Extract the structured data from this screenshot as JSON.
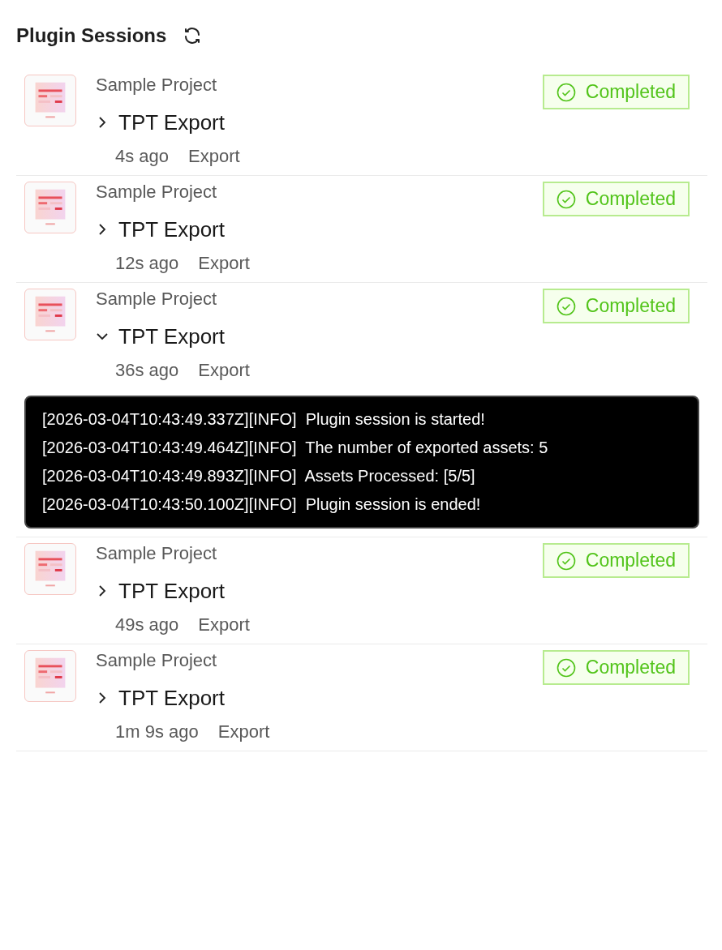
{
  "title": "Plugin Sessions",
  "sessions": [
    {
      "project": "Sample Project",
      "name": "TPT Export",
      "expanded": false,
      "time": "4s ago",
      "type": "Export",
      "status": {
        "kind": "completed",
        "label": "Completed"
      }
    },
    {
      "project": "Sample Project",
      "name": "TPT Export",
      "expanded": false,
      "time": "12s ago",
      "type": "Export",
      "status": {
        "kind": "completed",
        "label": "Completed"
      }
    },
    {
      "project": "Sample Project",
      "name": "TPT Export",
      "expanded": true,
      "time": "36s ago",
      "type": "Export",
      "status": {
        "kind": "completed",
        "label": "Completed"
      },
      "log": [
        "[2026-03-04T10:43:49.337Z][INFO]  Plugin session is started!",
        "[2026-03-04T10:43:49.464Z][INFO]  The number of exported assets: 5",
        "[2026-03-04T10:43:49.893Z][INFO]  Assets Processed: [5/5]",
        "[2026-03-04T10:43:50.100Z][INFO]  Plugin session is ended!"
      ]
    },
    {
      "project": "Sample Project",
      "name": "TPT Export",
      "expanded": false,
      "time": "49s ago",
      "type": "Export",
      "status": {
        "kind": "completed",
        "label": "Completed"
      }
    },
    {
      "project": "Sample Project",
      "name": "TPT Export",
      "expanded": false,
      "time": "1m 9s ago",
      "type": "Export",
      "status": {
        "kind": "completed",
        "label": "Completed"
      }
    }
  ]
}
